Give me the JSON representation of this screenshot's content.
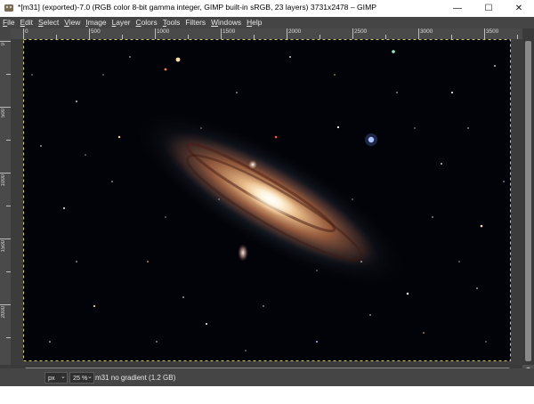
{
  "window": {
    "title": "*[m31] (exported)-7.0 (RGB color 8-bit gamma integer, GIMP built-in sRGB, 23 layers) 3731x2478 – GIMP",
    "minimize_glyph": "—",
    "maximize_glyph": "☐",
    "close_glyph": "✕"
  },
  "menu": [
    {
      "mn": "F",
      "rest": "ile"
    },
    {
      "mn": "E",
      "rest": "dit"
    },
    {
      "mn": "S",
      "rest": "elect"
    },
    {
      "mn": "V",
      "rest": "iew"
    },
    {
      "mn": "I",
      "rest": "mage"
    },
    {
      "mn": "L",
      "rest": "ayer"
    },
    {
      "mn": "C",
      "rest": "olors"
    },
    {
      "mn": "T",
      "rest": "ools"
    },
    {
      "mn": "",
      "rest": "Filters"
    },
    {
      "mn": "W",
      "rest": "indows"
    },
    {
      "mn": "H",
      "rest": "elp"
    }
  ],
  "ruler": {
    "h_labels": [
      "0",
      "500",
      "1000",
      "1500",
      "2000",
      "2500",
      "3000",
      "3500"
    ],
    "v_labels": [
      "0",
      "500",
      "1000",
      "1500",
      "2000"
    ]
  },
  "status": {
    "unit": "px",
    "zoom": "25 %",
    "text": "m31 no gradient (1.2 GB)"
  },
  "icons": {
    "app": "gimp-icon",
    "dropdown": "chevron-down-icon",
    "navigate": "navigate-icon"
  },
  "image": {
    "subject": "Andromeda galaxy M31 astrophotograph",
    "background_color": "#020308",
    "core_color": "#fff8e6",
    "arm_color": "#c97a4a",
    "halo_color": "#7a8fa0"
  }
}
